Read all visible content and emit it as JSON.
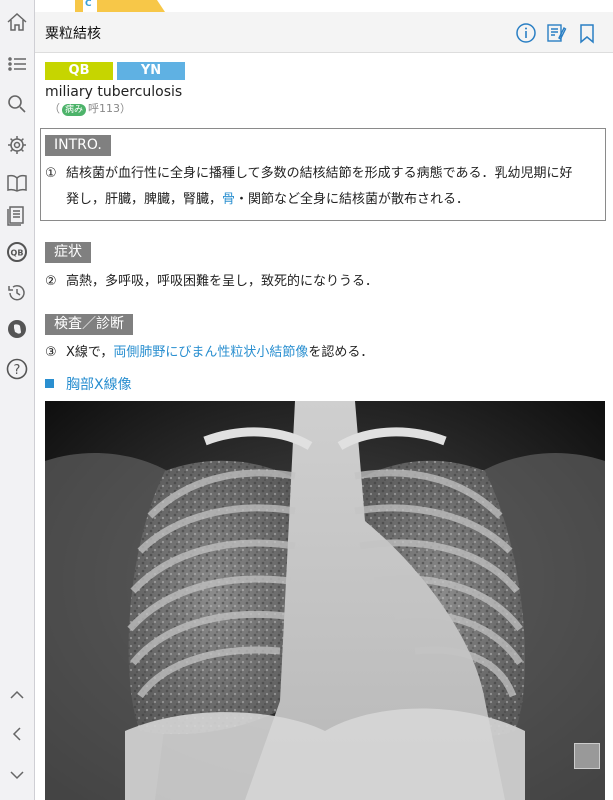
{
  "tab": {
    "letter": "C"
  },
  "header": {
    "title": "粟粒結核"
  },
  "badges": {
    "qb": "QB",
    "yn": "YN"
  },
  "entry": {
    "english": "miliary tuberculosis",
    "ref_open": "（",
    "ref_pill": "病み",
    "ref_code": "呼113）"
  },
  "intro": {
    "heading": "INTRO.",
    "num": "①",
    "line1": "結核菌が血行性に全身に播種して多数の結核結節を形成する病態である．乳幼児期に好",
    "line2_a": "発し，肝臓，脾臓，腎臓，",
    "line2_link": "骨",
    "line2_b": "・関節など全身に結核菌が散布される．"
  },
  "symptoms": {
    "heading": "症状",
    "num": "②",
    "text": "高熱，多呼吸，呼吸困難を呈し，致死的になりうる．"
  },
  "exam": {
    "heading": "検査／診断",
    "num": "③",
    "text_a": "X線で，",
    "link": "両側肺野にびまん性粒状小結節像",
    "text_b": "を認める．"
  },
  "figure": {
    "title": "胸部X線像"
  },
  "colors": {
    "accent": "#2a8fd0",
    "qb": "#c6d500",
    "yn": "#5fb1e3",
    "section": "#808080"
  }
}
